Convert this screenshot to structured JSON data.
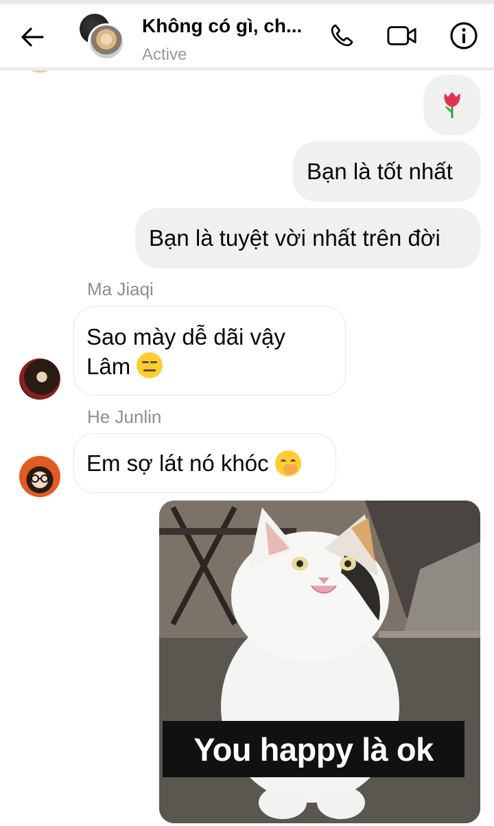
{
  "header": {
    "title": "Không có gì, ch...",
    "status": "Active"
  },
  "messages": [
    {
      "direction": "out",
      "type": "emoji",
      "content": "tulip"
    },
    {
      "direction": "out",
      "type": "text",
      "text": "Bạn là tốt nhất"
    },
    {
      "direction": "out",
      "type": "text",
      "text": "Bạn là tuyệt vời nhất trên đời"
    },
    {
      "direction": "in",
      "sender": "Ma Jiaqi",
      "line1": "Sao mày dễ dãi vậy",
      "line2": "Lâm",
      "emoji": "expressionless-face"
    },
    {
      "direction": "in",
      "sender": "He Junlin",
      "text": "Em sợ lát nó khóc",
      "emoji": "face-with-hand-over-mouth"
    },
    {
      "direction": "out",
      "type": "image",
      "caption": "You happy là ok",
      "subject": "smiling white cat meme"
    }
  ],
  "colors": {
    "outgoing_bubble": "#f0f0f0",
    "incoming_border": "#e4e6eb",
    "sender_name": "#8a8d91",
    "status_text": "#9a9a9a"
  },
  "icons": [
    "back-arrow-icon",
    "phone-icon",
    "video-camera-icon",
    "info-icon"
  ]
}
